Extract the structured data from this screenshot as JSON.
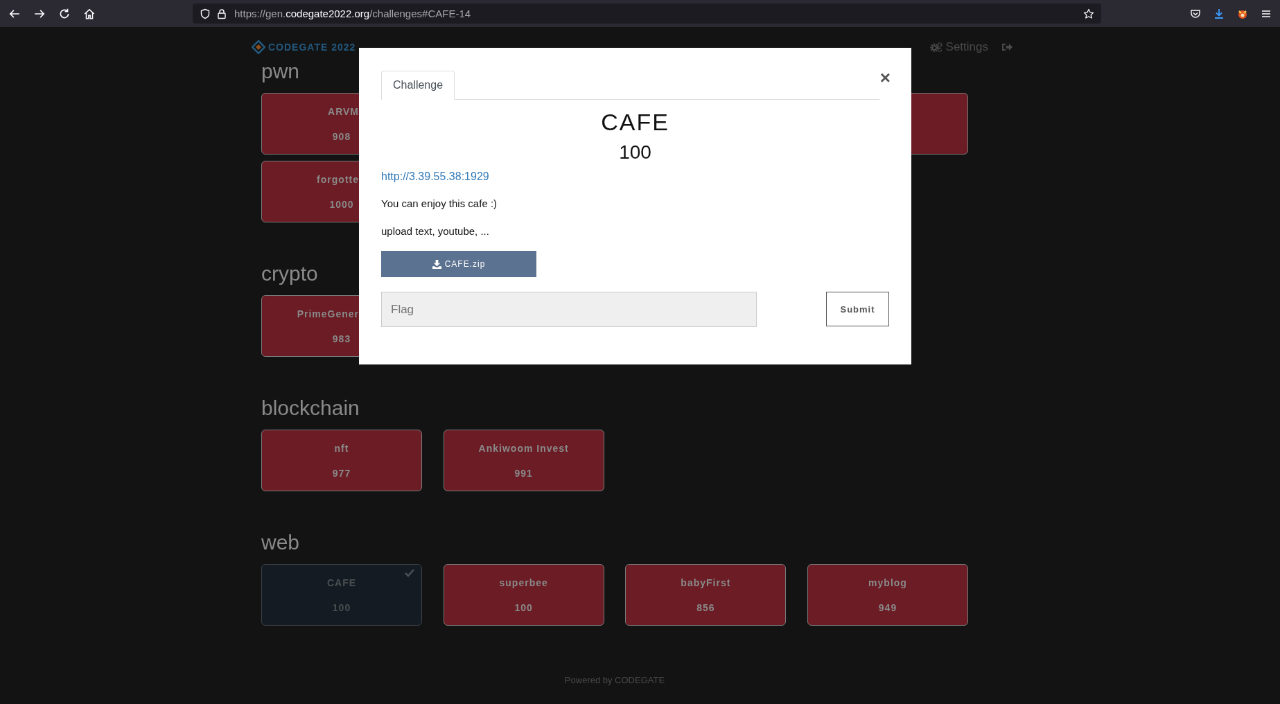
{
  "browser": {
    "url_prefix": "https://gen.",
    "url_domain": "codegate2022.org",
    "url_path": "/challenges#CAFE-14"
  },
  "navbar": {
    "logo": "CODEGATE 2022",
    "right": [
      {
        "kind": "gears",
        "label": "Settings"
      },
      {
        "kind": "logout"
      }
    ]
  },
  "categories": [
    {
      "name": "pwn",
      "rows": [
        [
          {
            "kind": "cut",
            "name": "ARVM",
            "score": "908",
            "solved": false
          },
          {
            "kind": "far",
            "solved": false
          }
        ],
        [
          {
            "kind": "cut",
            "name": "forgotte",
            "score": "1000",
            "solved": false
          }
        ]
      ]
    },
    {
      "name": "crypto",
      "rows": [
        [
          {
            "kind": "cut",
            "name": "PrimeGener",
            "score": "983",
            "solved": false
          }
        ]
      ]
    },
    {
      "name": "blockchain",
      "rows": [
        [
          {
            "kind": "full",
            "name": "nft",
            "score": "977",
            "solved": false
          },
          {
            "kind": "full",
            "name": "Ankiwoom Invest",
            "score": "991",
            "solved": false
          }
        ]
      ]
    },
    {
      "name": "web",
      "rows": [
        [
          {
            "kind": "full",
            "name": "CAFE",
            "score": "100",
            "solved": true
          },
          {
            "kind": "full",
            "name": "superbee",
            "score": "100",
            "solved": false
          },
          {
            "kind": "full",
            "name": "babyFirst",
            "score": "856",
            "solved": false
          },
          {
            "kind": "full",
            "name": "myblog",
            "score": "949",
            "solved": false
          }
        ]
      ]
    }
  ],
  "footer": "Powered by CODEGATE",
  "modal": {
    "tabs": [
      {
        "label": "Challenge",
        "selected": true
      }
    ],
    "close": "×",
    "title": "CAFE",
    "value": "100",
    "link": "http://3.39.55.38:1929",
    "description": [
      "You can enjoy this cafe :)",
      "upload text, youtube, ..."
    ],
    "file": "CAFE.zip",
    "flag": {
      "placeholder": "Flag"
    },
    "submit": "Submit"
  }
}
